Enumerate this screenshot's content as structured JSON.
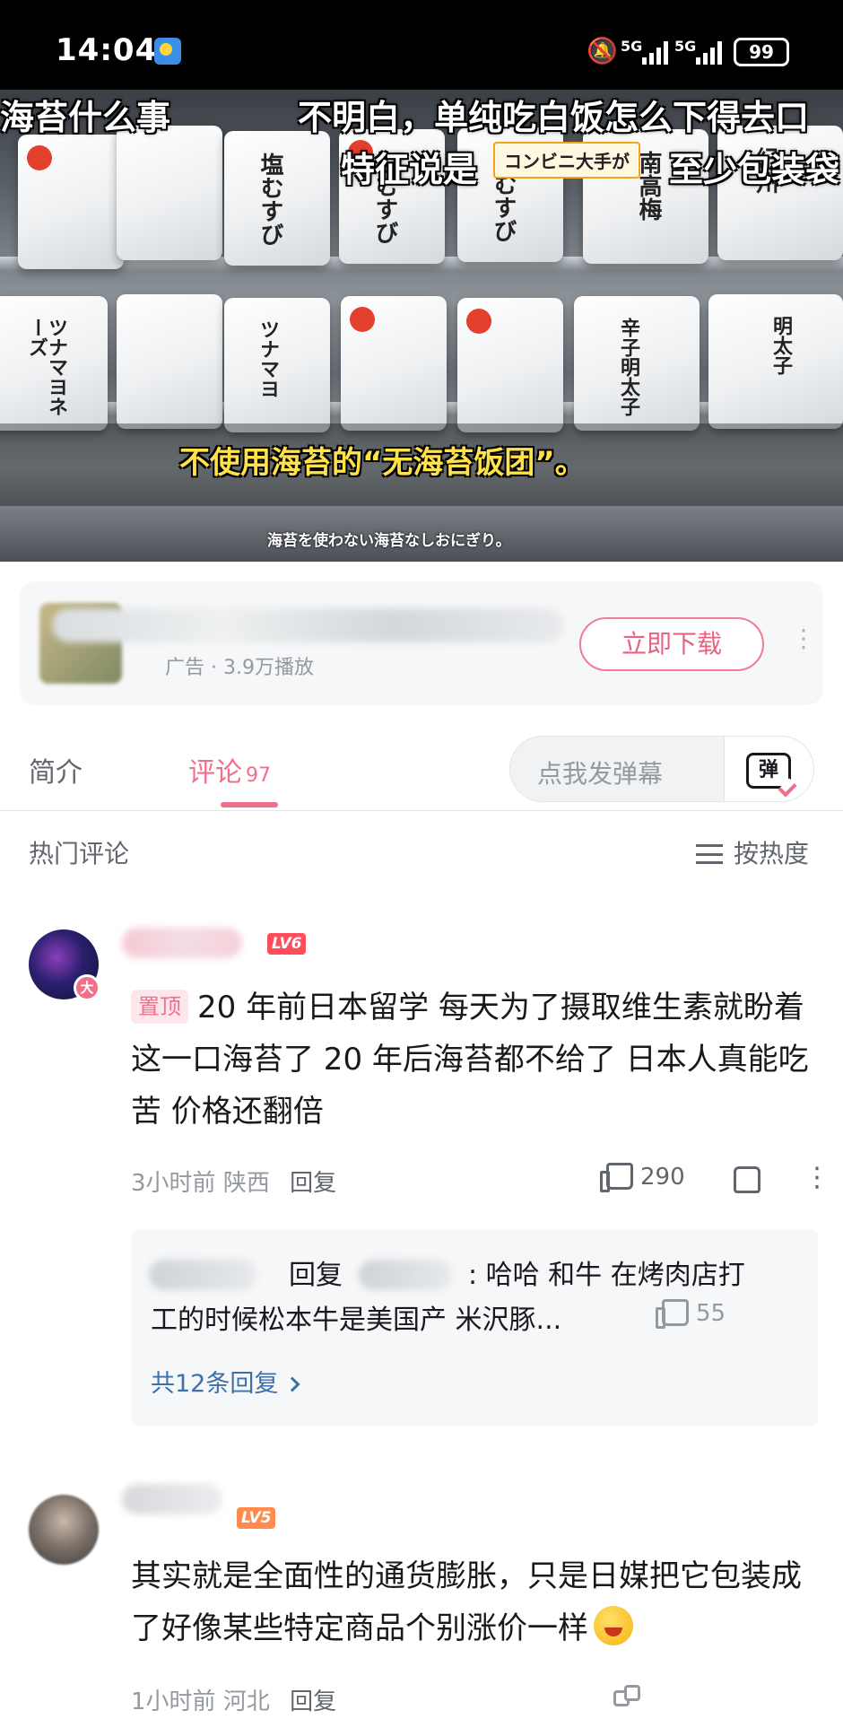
{
  "status_bar": {
    "time": "14:04",
    "network1": "5G",
    "network2": "5G",
    "battery": "99",
    "icons": [
      "weather-icon",
      "mute-icon",
      "signal-icon",
      "battery-icon"
    ]
  },
  "video": {
    "subtitle_top_left": "海苔什么事",
    "subtitle_top_right": "不明白，单纯吃白饭怎么下得去口",
    "subtitle_second_left": "特征说是",
    "subtitle_second_right": "至少包装袋",
    "jp_caption_tag": "コンビニ大手が",
    "subtitle_main": "不使用海苔的“无海苔饭团”。",
    "subtitle_jp": "海苔を使わない海苔なしおにぎり。",
    "package_text": [
      "塩むすび",
      "塩むすび",
      "塩むすび",
      "南高梅",
      "紀州",
      "ツナマヨネーズ",
      "ツナマヨ",
      "辛子明太子",
      "明太子"
    ]
  },
  "ad_card": {
    "meta": "广告 · 3.9万播放",
    "download_label": "立即下载",
    "more_label": "⋮"
  },
  "tabs": {
    "intro_label": "简介",
    "comments_label": "评论",
    "comments_count": "97",
    "danmaku_placeholder": "点我发弹幕",
    "danmaku_icon_text": "弹"
  },
  "comments_header": {
    "hot_label": "热门评论",
    "sort_label": "按热度"
  },
  "comments": [
    {
      "level": "LV6",
      "pinned_label": "置顶",
      "text": "20 年前日本留学 每天为了摄取维生素就盼着这一口海苔了 20 年后海苔都不给了 日本人真能吃苦 价格还翻倍",
      "time": "3小时前",
      "location": "陕西",
      "reply_label": "回复",
      "likes": "290",
      "avatar_badge": "大",
      "replies": {
        "reply_word": "回复",
        "reply_text_line1": ": 哈哈 和牛 在烤肉店打",
        "reply_text_line2": "工的时候松本牛是美国产 米沢豚...",
        "reply_likes": "55",
        "more_label": "共12条回复"
      }
    },
    {
      "level": "LV5",
      "text": "其实就是全面性的通货膨胀，只是日媒把它包装成了好像某些特定商品个别涨价一样",
      "time": "1小时前",
      "location": "河北",
      "reply_label": "回复"
    }
  ],
  "colors": {
    "accent_pink": "#f0708c",
    "subtitle_yellow": "#ffe14a",
    "link_blue": "#3d6fa8",
    "muted_gray": "#9499a0"
  }
}
